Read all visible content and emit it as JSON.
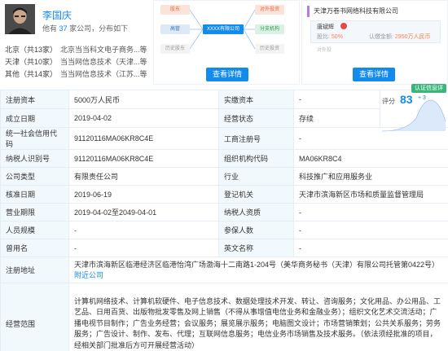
{
  "person": {
    "name": "李国庆",
    "sub_prefix": "他有",
    "sub_count": "37",
    "sub_suffix": "家公司，分布如下",
    "regions": [
      {
        "region": "北京",
        "count_text": "（共13家）",
        "company": "北京当当科文电子商务...等"
      },
      {
        "region": "天津",
        "count_text": "（共10家）",
        "company": "当当网信息技术（天津...等"
      },
      {
        "region": "其他",
        "count_text": "（共14家）",
        "company": "当当网信息技术（江苏...等"
      }
    ]
  },
  "equity": {
    "top_left": "股东",
    "top_right": "对外投资",
    "mid_left": "高管",
    "center": "XXXX有限公司",
    "mid_right": "分支机构",
    "bottom_left": "历史股东",
    "bottom_right": "历史投资",
    "button": "查看详情"
  },
  "relation": {
    "title": "天津万卷书网络科技有限公司",
    "card_name": "唐斌辉",
    "share_label": "股比:",
    "share_value": "50%",
    "capital_label": "认缴金额:",
    "capital_value": "2950万人民币",
    "foot": "对外投",
    "button": "查看详情"
  },
  "table": {
    "reg_capital_label": "注册资本",
    "reg_capital": "5000万人民币",
    "paid_capital_label": "实缴资本",
    "paid_capital": "-",
    "found_date_label": "成立日期",
    "found_date": "2019-04-02",
    "status_label": "经营状态",
    "status": "存续",
    "credit_code_label": "统一社会信用代码",
    "credit_code": "91120116MA06KR8C4E",
    "reg_no_label": "工商注册号",
    "reg_no": "-",
    "taxpayer_label": "纳税人识别号",
    "taxpayer": "91120116MA06KR8C4E",
    "org_code_label": "组织机构代码",
    "org_code": "MA06KR8C4",
    "type_label": "公司类型",
    "type": "有限责任公司",
    "industry_label": "行业",
    "industry": "科技推广和应用服务业",
    "approve_label": "核准日期",
    "approve": "2019-06-19",
    "authority_label": "登记机关",
    "authority": "天津市滨海新区市场和质量监督管理局",
    "term_label": "营业期限",
    "term": "2019-04-02至2049-04-01",
    "tax_qual_label": "纳税人资质",
    "tax_qual": "-",
    "staff_label": "人员规模",
    "staff": "-",
    "insured_label": "参保人数",
    "insured": "-",
    "former_label": "曾用名",
    "former": "-",
    "english_label": "英文名称",
    "english": "-",
    "address_label": "注册地址",
    "address": "天津市滨海新区临港经济区临港怡湾广场渤海十二南路1-204号（美华商务秘书（天津）有限公司托管第0422号）",
    "address_link": "附近公司",
    "scope_label": "经营范围",
    "scope": "计算机网络技术、计算机软硬件、电子信息技术、数据处理技术开发、转让、咨询服务；文化用品、办公用品、工艺品、日用百货、出版物批发零售及网上销售（不得从事增值电信业务和金融业务）；组织文化艺术交流活动；广播电视节目制作；广告业务经营；会议服务；展览展示服务；电脑图文设计；市场营销策划；公共关系服务；劳务服务；广告设计、制作、发布、代理；互联网信息服务；电信业务市场销售及技术服务。（依法须经批准的项目，经相关部门批准后方可开展经营活动）"
  },
  "score": {
    "badge": "认证信息详",
    "label": "评分",
    "value": "83",
    "delta": "+ 3"
  },
  "colors": {
    "accent": "#128bed",
    "label_bg": "#f2f9fc",
    "border": "#e4eef6",
    "badge": "#3bb67a"
  }
}
